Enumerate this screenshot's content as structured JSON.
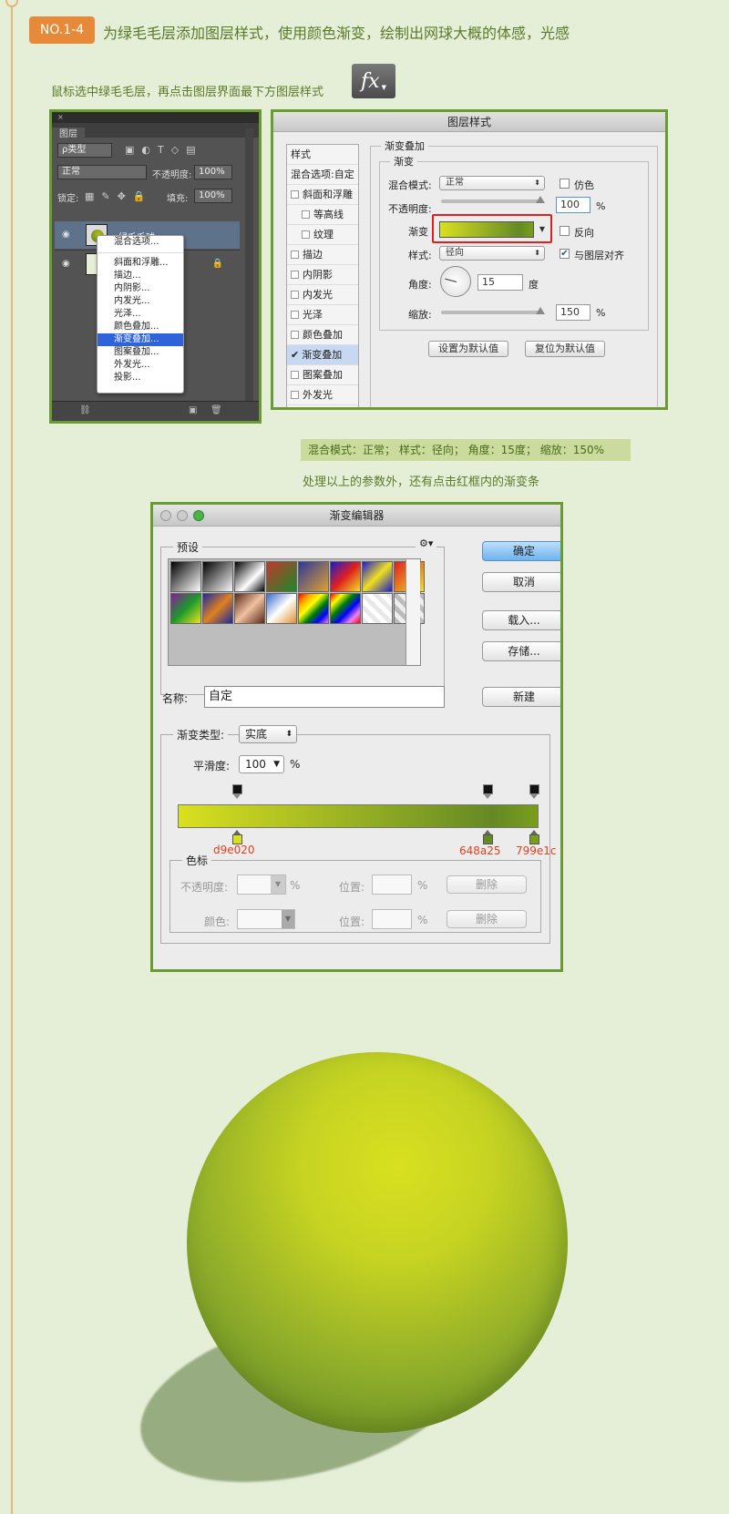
{
  "header": {
    "badge": "NO.1-4",
    "title": "为绿毛毛层添加图层样式，使用颜色渐变，绘制出网球大概的体感，光感"
  },
  "instruction": {
    "text": "鼠标选中绿毛毛层，再点击图层界面最下方图层样式",
    "fx_label": "fx"
  },
  "layers_panel": {
    "tab": "图层",
    "filter_label": "ρ类型",
    "blend_mode": "正常",
    "opacity_label": "不透明度:",
    "opacity_value": "100%",
    "lock_label": "锁定:",
    "fill_label": "填充:",
    "fill_value": "100%",
    "layer_name": "绿毛毛球"
  },
  "context_menu": {
    "items": [
      "混合选项...",
      "斜面和浮雕...",
      "描边...",
      "内阴影...",
      "内发光...",
      "光泽...",
      "颜色叠加...",
      "渐变叠加...",
      "图案叠加...",
      "外发光...",
      "投影..."
    ],
    "selected": "渐变叠加..."
  },
  "layer_style": {
    "title": "图层样式",
    "sidebar": [
      "样式",
      "混合选项:自定",
      "斜面和浮雕",
      "等高线",
      "纹理",
      "描边",
      "内阴影",
      "内发光",
      "光泽",
      "颜色叠加",
      "渐变叠加",
      "图案叠加",
      "外发光"
    ],
    "section_title": "渐变叠加",
    "group_title": "渐变",
    "blend_label": "混合模式:",
    "blend_value": "正常",
    "dither_label": "仿色",
    "opacity_label": "不透明度:",
    "opacity_value": "100",
    "percent": "%",
    "gradient_label": "渐变",
    "reverse_label": "反向",
    "style_label": "样式:",
    "style_value": "径向",
    "align_label": "与图层对齐",
    "angle_label": "角度:",
    "angle_value": "15",
    "angle_unit": "度",
    "scale_label": "缩放:",
    "scale_value": "150",
    "default_btn": "设置为默认值",
    "reset_btn": "复位为默认值"
  },
  "notes": {
    "params": "混合模式：正常；  样式：径向；  角度：15度；  缩放：150%",
    "hint": "处理以上的参数外，还有点击红框内的渐变条"
  },
  "gradient_editor": {
    "title": "渐变编辑器",
    "presets_label": "预设",
    "ok": "确定",
    "cancel": "取消",
    "load": "载入...",
    "save": "存储...",
    "name_label": "名称:",
    "name_value": "自定",
    "new_btn": "新建",
    "type_label": "渐变类型:",
    "type_value": "实底",
    "smooth_label": "平滑度:",
    "smooth_value": "100",
    "percent": "%",
    "stops_group": "色标",
    "opacity_label": "不透明度:",
    "position_label": "位置:",
    "delete_label": "删除",
    "color_label": "颜色:",
    "stops": [
      {
        "hex": "d9e020",
        "color": "#d9e020",
        "pos": 0
      },
      {
        "hex": "648a25",
        "color": "#648a25",
        "pos": 87.7
      },
      {
        "hex": "799e1c",
        "color": "#799e1c",
        "pos": 100
      }
    ]
  },
  "colors": {
    "background": "#e5eed6",
    "accent_green": "#6a9a32",
    "badge": "#e68a3a"
  }
}
